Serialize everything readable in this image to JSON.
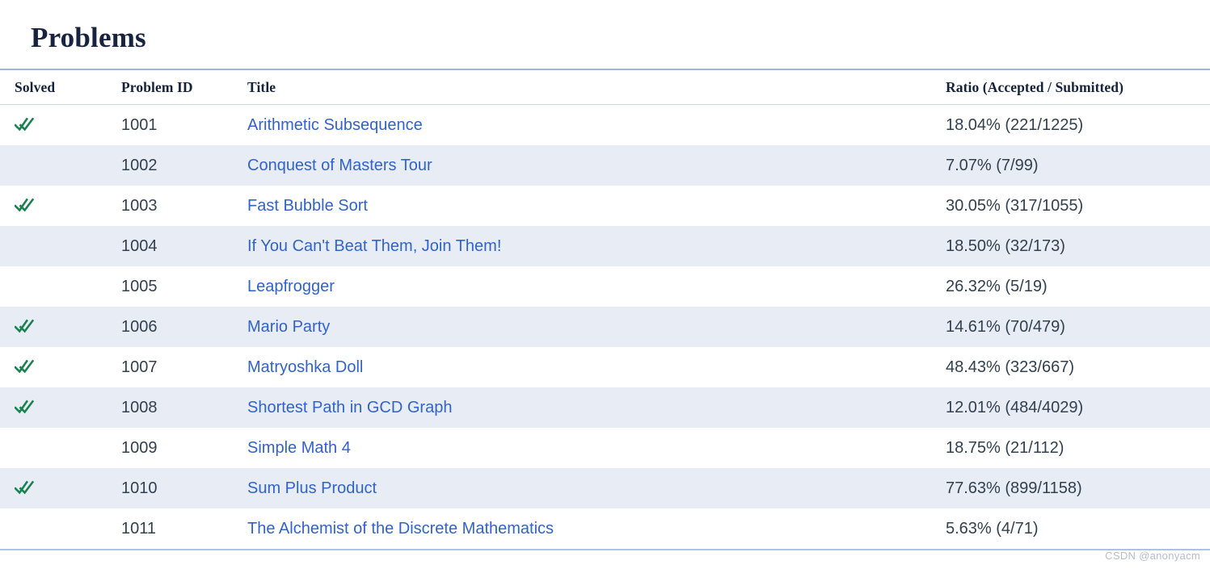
{
  "page": {
    "title": "Problems",
    "watermark": "CSDN @anonyacm"
  },
  "colors": {
    "heading": "#17233f",
    "link": "#3163cb",
    "solved_check": "#19824f",
    "stripe_row": "#e8ecf5",
    "table_top_border": "#9fb4d4",
    "table_bottom_border": "#aec3e0",
    "body_text": "#32404f",
    "watermark": "#b9bcc0"
  },
  "table": {
    "columns": [
      {
        "key": "solved",
        "label": "Solved"
      },
      {
        "key": "problem_id",
        "label": "Problem ID"
      },
      {
        "key": "title",
        "label": "Title"
      },
      {
        "key": "ratio",
        "label": "Ratio (Accepted / Submitted)"
      }
    ],
    "rows": [
      {
        "solved": true,
        "solved_icon": "double-check-icon",
        "problem_id": "1001",
        "title": "Arithmetic Subsequence",
        "ratio": "18.04% (221/1225)",
        "ratio_percent": 18.04,
        "accepted": 221,
        "submitted": 1225
      },
      {
        "solved": false,
        "solved_icon": "",
        "problem_id": "1002",
        "title": "Conquest of Masters Tour",
        "ratio": "7.07% (7/99)",
        "ratio_percent": 7.07,
        "accepted": 7,
        "submitted": 99
      },
      {
        "solved": true,
        "solved_icon": "double-check-icon",
        "problem_id": "1003",
        "title": "Fast Bubble Sort",
        "ratio": "30.05% (317/1055)",
        "ratio_percent": 30.05,
        "accepted": 317,
        "submitted": 1055
      },
      {
        "solved": false,
        "solved_icon": "",
        "problem_id": "1004",
        "title": "If You Can't Beat Them, Join Them!",
        "ratio": "18.50% (32/173)",
        "ratio_percent": 18.5,
        "accepted": 32,
        "submitted": 173
      },
      {
        "solved": false,
        "solved_icon": "",
        "problem_id": "1005",
        "title": "Leapfrogger",
        "ratio": "26.32% (5/19)",
        "ratio_percent": 26.32,
        "accepted": 5,
        "submitted": 19
      },
      {
        "solved": true,
        "solved_icon": "double-check-icon",
        "problem_id": "1006",
        "title": "Mario Party",
        "ratio": "14.61% (70/479)",
        "ratio_percent": 14.61,
        "accepted": 70,
        "submitted": 479
      },
      {
        "solved": true,
        "solved_icon": "double-check-icon",
        "problem_id": "1007",
        "title": "Matryoshka Doll",
        "ratio": "48.43% (323/667)",
        "ratio_percent": 48.43,
        "accepted": 323,
        "submitted": 667
      },
      {
        "solved": true,
        "solved_icon": "double-check-icon",
        "problem_id": "1008",
        "title": "Shortest Path in GCD Graph",
        "ratio": "12.01% (484/4029)",
        "ratio_percent": 12.01,
        "accepted": 484,
        "submitted": 4029
      },
      {
        "solved": false,
        "solved_icon": "",
        "problem_id": "1009",
        "title": "Simple Math 4",
        "ratio": "18.75% (21/112)",
        "ratio_percent": 18.75,
        "accepted": 21,
        "submitted": 112
      },
      {
        "solved": true,
        "solved_icon": "double-check-icon",
        "problem_id": "1010",
        "title": "Sum Plus Product",
        "ratio": "77.63% (899/1158)",
        "ratio_percent": 77.63,
        "accepted": 899,
        "submitted": 1158
      },
      {
        "solved": false,
        "solved_icon": "",
        "problem_id": "1011",
        "title": "The Alchemist of the Discrete Mathematics",
        "ratio": "5.63% (4/71)",
        "ratio_percent": 5.63,
        "accepted": 4,
        "submitted": 71
      }
    ]
  }
}
